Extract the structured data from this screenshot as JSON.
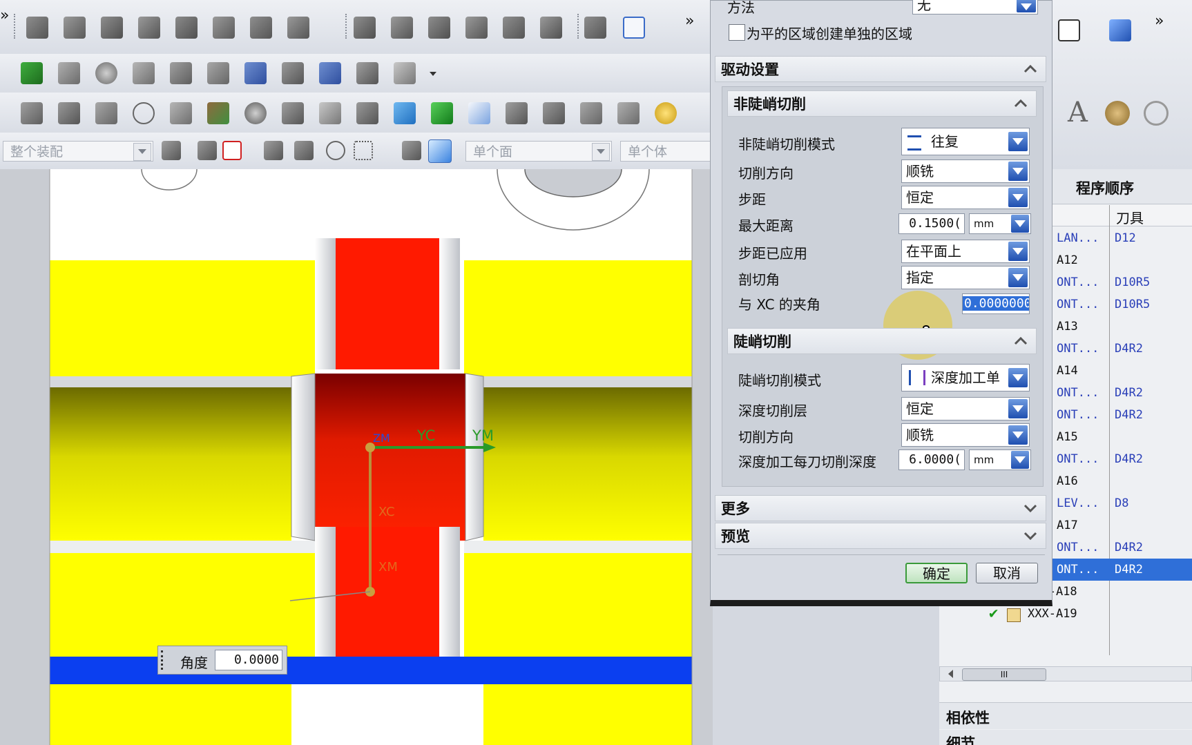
{
  "toolbar": {
    "assembly_combo": "整个装配",
    "face_combo": "单个面",
    "body_combo": "单个体",
    "overflow_glyph": "»"
  },
  "dialog": {
    "method_label": "方法",
    "method_value": "无",
    "separate_region_checkbox": "为平的区域创建单独的区域",
    "drive_settings_title": "驱动设置",
    "non_steep": {
      "title": "非陡峭切削",
      "pattern_label": "非陡峭切削模式",
      "pattern_value": "往复",
      "cut_direction_label": "切削方向",
      "cut_direction_value": "顺铣",
      "stepover_label": "步距",
      "stepover_value": "恒定",
      "max_distance_label": "最大距离",
      "max_distance_value": "0.1500(",
      "max_distance_unit": "mm",
      "stepover_applied_label": "步距已应用",
      "stepover_applied_value": "在平面上",
      "cut_angle_label": "剖切角",
      "cut_angle_value": "指定",
      "xc_angle_label": "与 XC 的夹角",
      "xc_angle_value": "0.0000000"
    },
    "steep": {
      "title": "陡峭切削",
      "pattern_label": "陡峭切削模式",
      "pattern_value": "深度加工单",
      "depth_levels_label": "深度切削层",
      "depth_levels_value": "恒定",
      "cut_direction_label": "切削方向",
      "cut_direction_value": "顺铣",
      "depth_per_cut_label": "深度加工每刀切削深度",
      "depth_per_cut_value": "6.0000(",
      "depth_per_cut_unit": "mm"
    },
    "more_title": "更多",
    "preview_title": "预览",
    "ok_button": "确定",
    "cancel_button": "取消"
  },
  "viewport": {
    "axis_yc": "YC",
    "axis_ym": "YM",
    "axis_xc": "XC",
    "axis_xm": "XM",
    "axis_zm": "ZM",
    "angle_label": "角度",
    "angle_value": "0.0000"
  },
  "navigator": {
    "title": "程序顺序",
    "col_tool": "刀具",
    "rows": [
      {
        "name": "LAN...",
        "tool": "D12"
      },
      {
        "name": "A12",
        "tool": ""
      },
      {
        "name": "ONT...",
        "tool": "D10R5"
      },
      {
        "name": "ONT...",
        "tool": "D10R5"
      },
      {
        "name": "A13",
        "tool": ""
      },
      {
        "name": "ONT...",
        "tool": "D4R2"
      },
      {
        "name": "A14",
        "tool": ""
      },
      {
        "name": "ONT...",
        "tool": "D4R2"
      },
      {
        "name": "ONT...",
        "tool": "D4R2"
      },
      {
        "name": "A15",
        "tool": ""
      },
      {
        "name": "ONT...",
        "tool": "D4R2"
      },
      {
        "name": "A16",
        "tool": ""
      },
      {
        "name": "LEV...",
        "tool": "D8"
      },
      {
        "name": "A17",
        "tool": ""
      },
      {
        "name": "ONT...",
        "tool": "D4R2"
      },
      {
        "name": "ONT...",
        "tool": "D4R2"
      },
      {
        "name": "XXX-A18",
        "tool": ""
      },
      {
        "name": "XXX-A19",
        "tool": ""
      }
    ],
    "dependencies_title": "相依性",
    "details_title": "细节",
    "scroll_thumb": "III"
  },
  "colors": {
    "yellow": "#ffff00",
    "red": "#ff1a00",
    "dialog_bg": "#d7dbe3",
    "selected_row": "#2f6fd8",
    "accent_blue": "#1f4fb0"
  }
}
